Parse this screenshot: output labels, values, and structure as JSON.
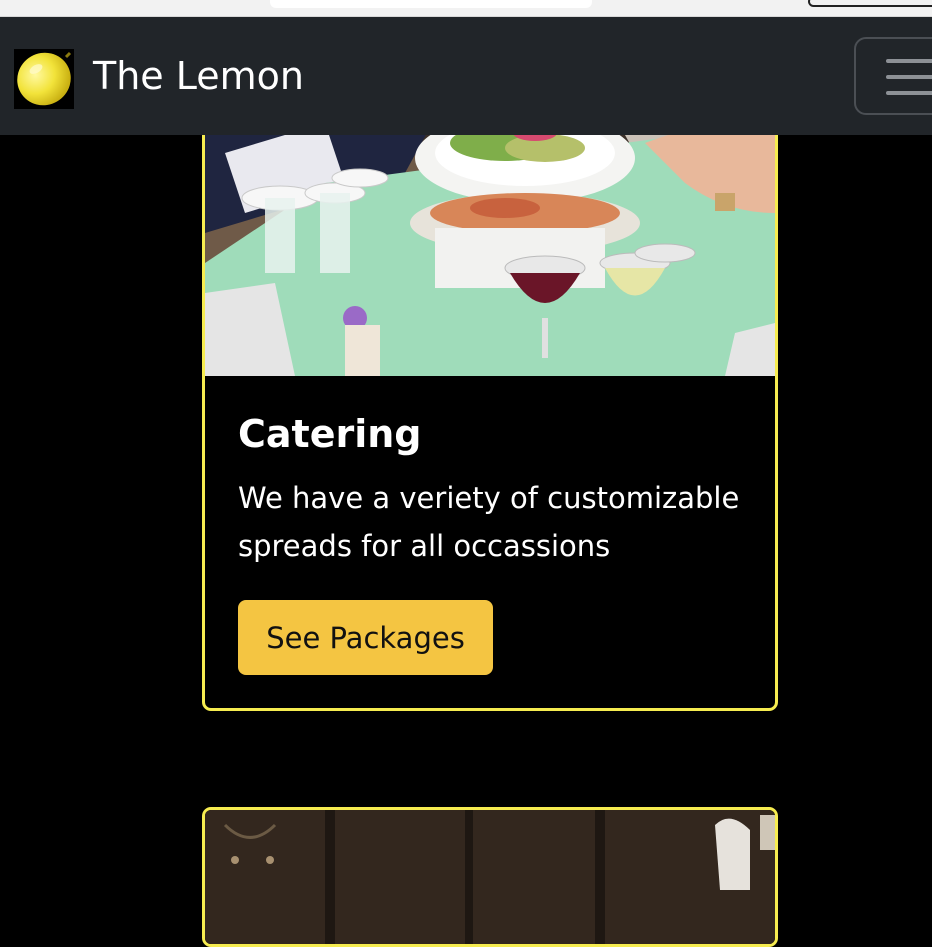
{
  "navbar": {
    "brand_name": "The Lemon",
    "logo_icon": "lemon-icon",
    "toggler_icon": "hamburger-menu-icon"
  },
  "cards": [
    {
      "title": "Catering",
      "text": "We have a veriety of customizable spreads for all occassions",
      "button_label": "See Packages",
      "image": "catering-table-photo"
    },
    {
      "image": "restaurant-interior-photo"
    }
  ],
  "colors": {
    "navbar_bg": "#212529",
    "page_bg": "#000000",
    "card_border": "#f6ec50",
    "button_bg": "#f4c542",
    "text": "#ffffff"
  }
}
